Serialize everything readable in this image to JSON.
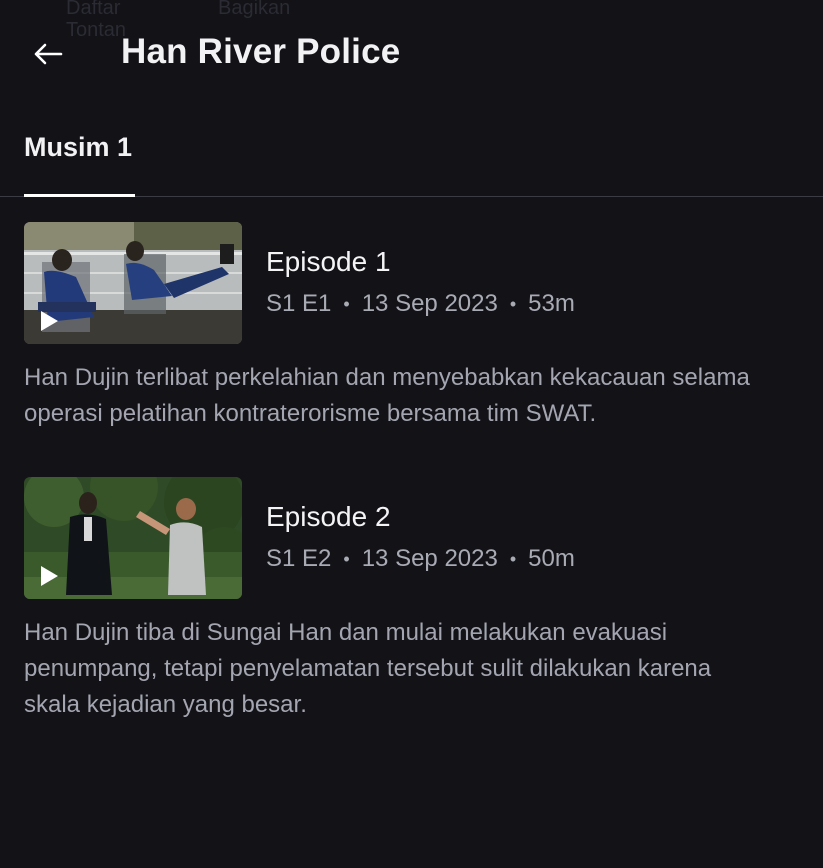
{
  "background_ghost": {
    "line1": "Daftar",
    "line2": "Tontan",
    "line3": "Bagikan"
  },
  "header": {
    "title": "Han River Police",
    "back_icon": "arrow-left-icon"
  },
  "tabs": [
    {
      "label": "Musim 1",
      "selected": true
    }
  ],
  "episodes": [
    {
      "title": "Episode 1",
      "code": "S1 E1",
      "date": "13 Sep 2023",
      "duration": "53m",
      "description": "Han Dujin terlibat perkelahian dan menyebabkan kekacauan selama operasi pelatihan kontraterorisme bersama tim SWAT.",
      "play_icon": "play-icon"
    },
    {
      "title": "Episode 2",
      "code": "S1 E2",
      "date": "13 Sep 2023",
      "duration": "50m",
      "description": "Han Dujin tiba di Sungai Han dan mulai melakukan evakuasi penumpang, tetapi penyelamatan tersebut sulit dilakukan karena skala kejadian yang besar.",
      "play_icon": "play-icon"
    }
  ],
  "colors": {
    "background": "#121217",
    "text": "#f2f2f5",
    "muted": "#a8aab4",
    "divider": "#3a3b43"
  }
}
